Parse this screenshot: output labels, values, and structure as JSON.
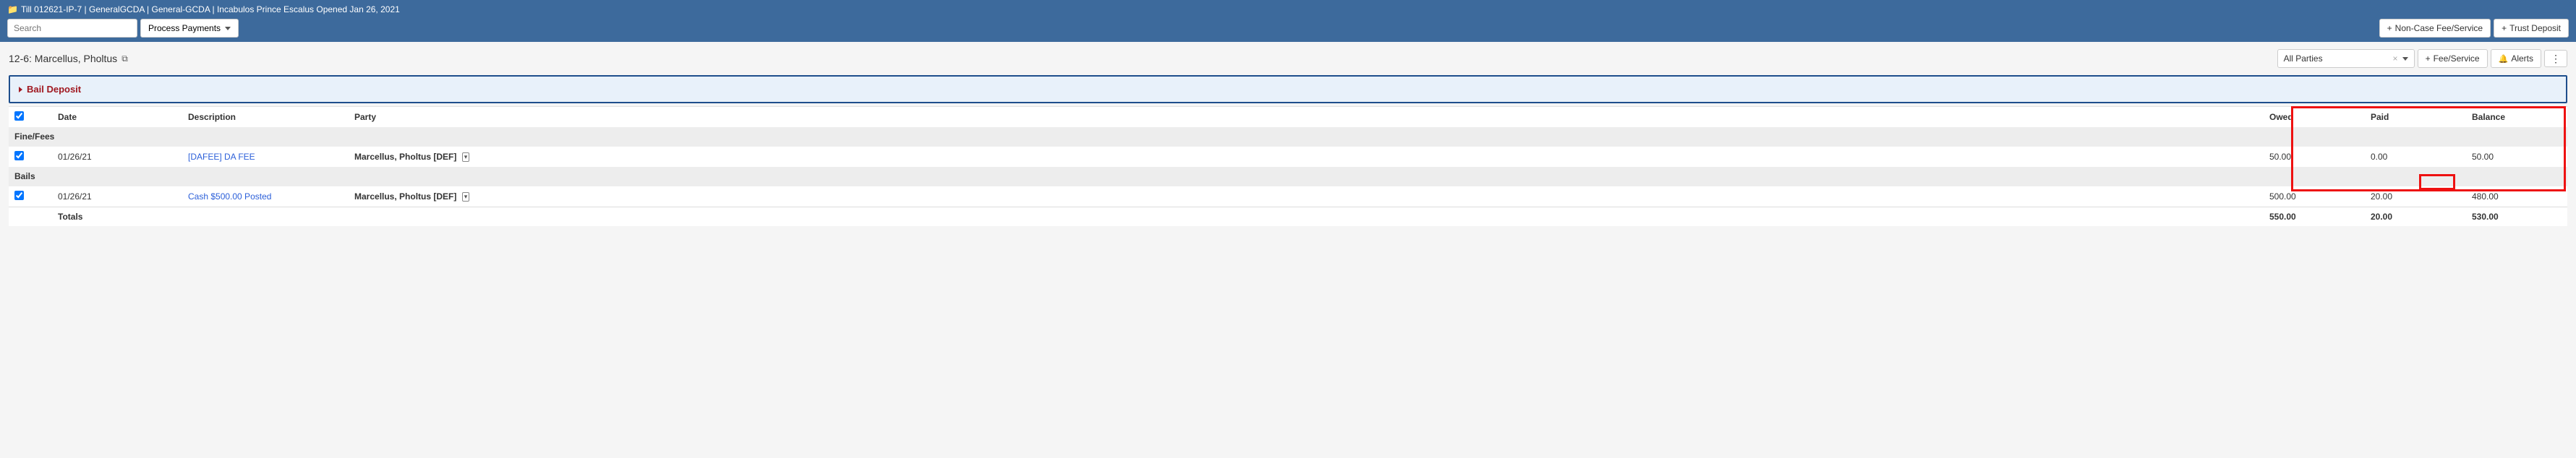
{
  "topbar": {
    "title": "Till 012621-IP-7 | GeneralGCDA | General-GCDA | Incabulos Prince Escalus Opened Jan 26, 2021",
    "search_placeholder": "Search",
    "process_btn": "Process Payments",
    "noncase_btn": "Non-Case Fee/Service",
    "trust_btn": "Trust Deposit"
  },
  "subhead": {
    "case_title": "12-6: Marcellus, Pholtus",
    "parties_label": "All Parties",
    "fee_service_btn": "Fee/Service",
    "alerts_btn": "Alerts"
  },
  "bail_panel": {
    "title": "Bail Deposit"
  },
  "table": {
    "headers": {
      "date": "Date",
      "description": "Description",
      "party": "Party",
      "owed": "Owed",
      "paid": "Paid",
      "balance": "Balance"
    },
    "sections": [
      {
        "label": "Fine/Fees",
        "rows": [
          {
            "date": "01/26/21",
            "description": "[DAFEE] DA FEE",
            "party": "Marcellus, Pholtus [DEF]",
            "owed": "50.00",
            "paid": "0.00",
            "balance": "50.00"
          }
        ]
      },
      {
        "label": "Bails",
        "rows": [
          {
            "date": "01/26/21",
            "description": "Cash $500.00 Posted",
            "party": "Marcellus, Pholtus [DEF]",
            "owed": "500.00",
            "paid": "20.00",
            "balance": "480.00"
          }
        ]
      }
    ],
    "totals": {
      "label": "Totals",
      "owed": "550.00",
      "paid": "20.00",
      "balance": "530.00"
    }
  }
}
